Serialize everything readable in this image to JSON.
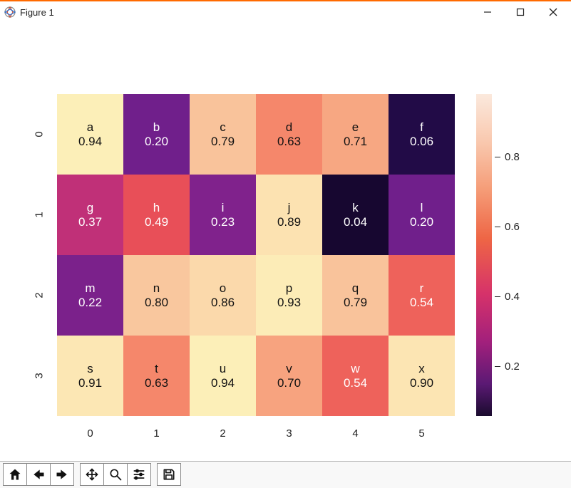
{
  "window": {
    "title": "Figure 1"
  },
  "chart_data": {
    "type": "heatmap",
    "x_labels": [
      "0",
      "1",
      "2",
      "3",
      "4",
      "5"
    ],
    "y_labels": [
      "0",
      "1",
      "2",
      "3"
    ],
    "colorbar_ticks": [
      "0.8",
      "0.6",
      "0.4",
      "0.2"
    ],
    "colormap": "magma_r",
    "cells": [
      [
        {
          "label": "a",
          "value": "0.94",
          "num": 0.94
        },
        {
          "label": "b",
          "value": "0.20",
          "num": 0.2
        },
        {
          "label": "c",
          "value": "0.79",
          "num": 0.79
        },
        {
          "label": "d",
          "value": "0.63",
          "num": 0.63
        },
        {
          "label": "e",
          "value": "0.71",
          "num": 0.71
        },
        {
          "label": "f",
          "value": "0.06",
          "num": 0.06
        }
      ],
      [
        {
          "label": "g",
          "value": "0.37",
          "num": 0.37
        },
        {
          "label": "h",
          "value": "0.49",
          "num": 0.49
        },
        {
          "label": "i",
          "value": "0.23",
          "num": 0.23
        },
        {
          "label": "j",
          "value": "0.89",
          "num": 0.89
        },
        {
          "label": "k",
          "value": "0.04",
          "num": 0.04
        },
        {
          "label": "l",
          "value": "0.20",
          "num": 0.2
        }
      ],
      [
        {
          "label": "m",
          "value": "0.22",
          "num": 0.22
        },
        {
          "label": "n",
          "value": "0.80",
          "num": 0.8
        },
        {
          "label": "o",
          "value": "0.86",
          "num": 0.86
        },
        {
          "label": "p",
          "value": "0.93",
          "num": 0.93
        },
        {
          "label": "q",
          "value": "0.79",
          "num": 0.79
        },
        {
          "label": "r",
          "value": "0.54",
          "num": 0.54
        }
      ],
      [
        {
          "label": "s",
          "value": "0.91",
          "num": 0.91
        },
        {
          "label": "t",
          "value": "0.63",
          "num": 0.63
        },
        {
          "label": "u",
          "value": "0.94",
          "num": 0.94
        },
        {
          "label": "v",
          "value": "0.70",
          "num": 0.7
        },
        {
          "label": "w",
          "value": "0.54",
          "num": 0.54
        },
        {
          "label": "x",
          "value": "0.90",
          "num": 0.9
        }
      ]
    ]
  },
  "toolbar": {
    "buttons": [
      "home",
      "back",
      "forward",
      "pan",
      "zoom",
      "configure",
      "save"
    ]
  }
}
